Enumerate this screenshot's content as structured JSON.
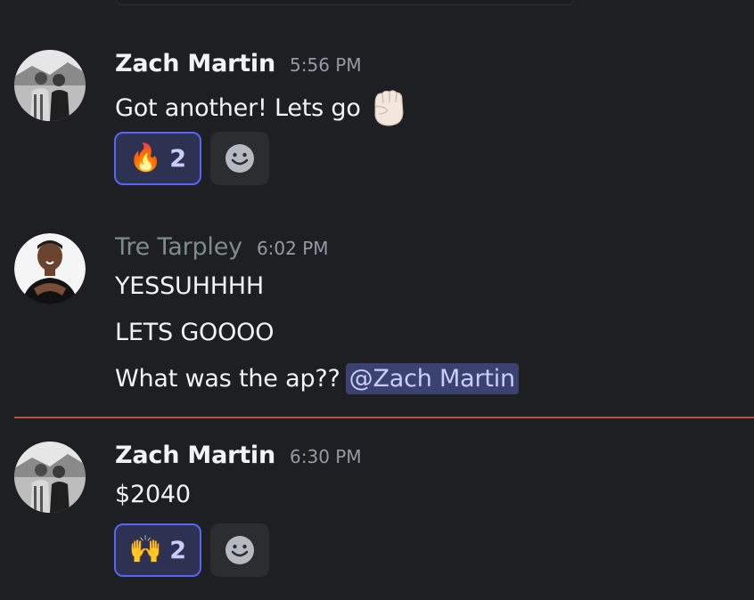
{
  "messages": [
    {
      "author": "Zach Martin",
      "time": "5:56 PM",
      "lines": [
        "Got another! Lets go"
      ],
      "inline_emoji": "raised-fist",
      "reactions": [
        {
          "emoji": "🔥",
          "count": "2"
        }
      ]
    },
    {
      "author": "Tre Tarpley",
      "time": "6:02 PM",
      "lines": [
        "YESSUHHHH",
        "LETS GOOOO",
        "What was the ap??"
      ],
      "mention": "@Zach Martin"
    },
    {
      "author": "Zach Martin",
      "time": "6:30 PM",
      "lines": [
        "$2040"
      ],
      "reactions": [
        {
          "emoji": "🙌",
          "count": "2"
        }
      ]
    }
  ],
  "colors": {
    "background": "#1e1f22",
    "accent": "#5865f2",
    "mention_bg": "#3c4270",
    "new_message_divider": "#c24a4a"
  },
  "icons": [
    "add-reaction-smiley-icon",
    "raised-fist-emoji"
  ]
}
